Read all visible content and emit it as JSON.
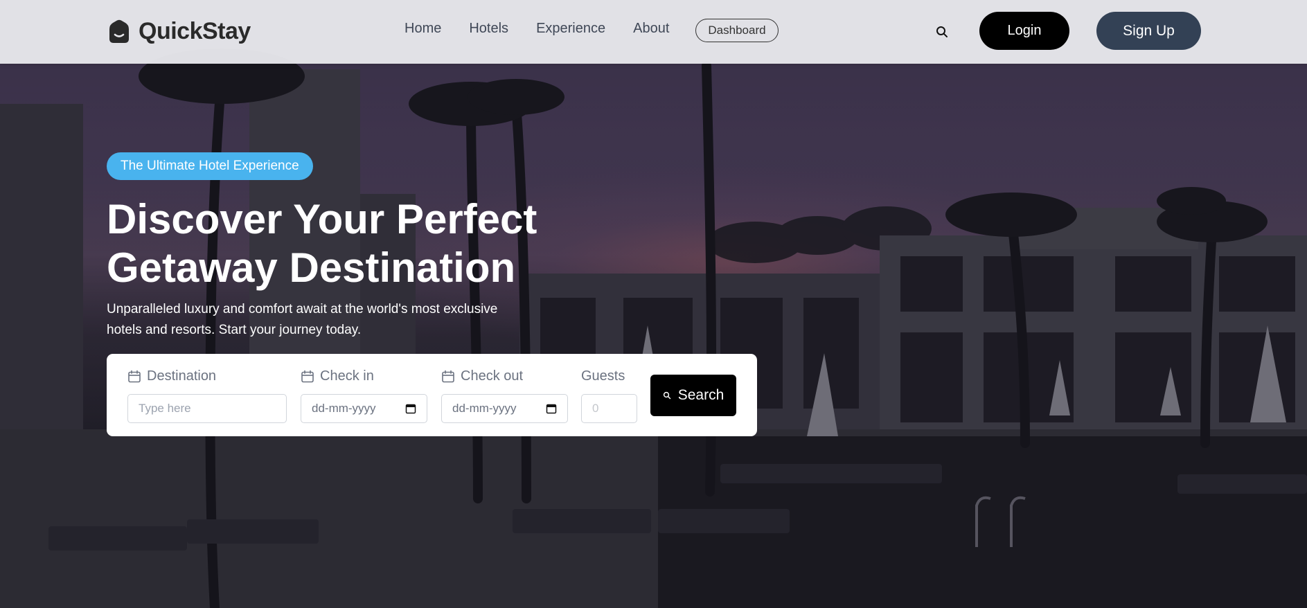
{
  "brand": {
    "name": "QuickStay"
  },
  "nav": {
    "links": [
      "Home",
      "Hotels",
      "Experience",
      "About"
    ],
    "dashboard_label": "Dashboard",
    "login_label": "Login",
    "signup_label": "Sign Up"
  },
  "hero": {
    "badge": "The Ultimate Hotel Experience",
    "title_line1": "Discover Your Perfect",
    "title_line2": "Getaway Destination",
    "subtitle": "Unparalleled luxury and comfort await at the world's most exclusive hotels and resorts. Start your journey today."
  },
  "search_form": {
    "destination": {
      "label": "Destination",
      "placeholder": "Type here"
    },
    "check_in": {
      "label": "Check in",
      "placeholder": "dd-mm-yyyy"
    },
    "check_out": {
      "label": "Check out",
      "placeholder": "dd-mm-yyyy"
    },
    "guests": {
      "label": "Guests",
      "placeholder": "0"
    },
    "submit_label": "Search"
  },
  "icons": {
    "nav_search": "search-icon",
    "field_icon": "calendar-icon",
    "submit_icon": "search-icon"
  },
  "colors": {
    "badge": "#49b3ee",
    "login_button": "#000000",
    "signup_button": "#334155",
    "navbar": "#e8e8ec"
  }
}
